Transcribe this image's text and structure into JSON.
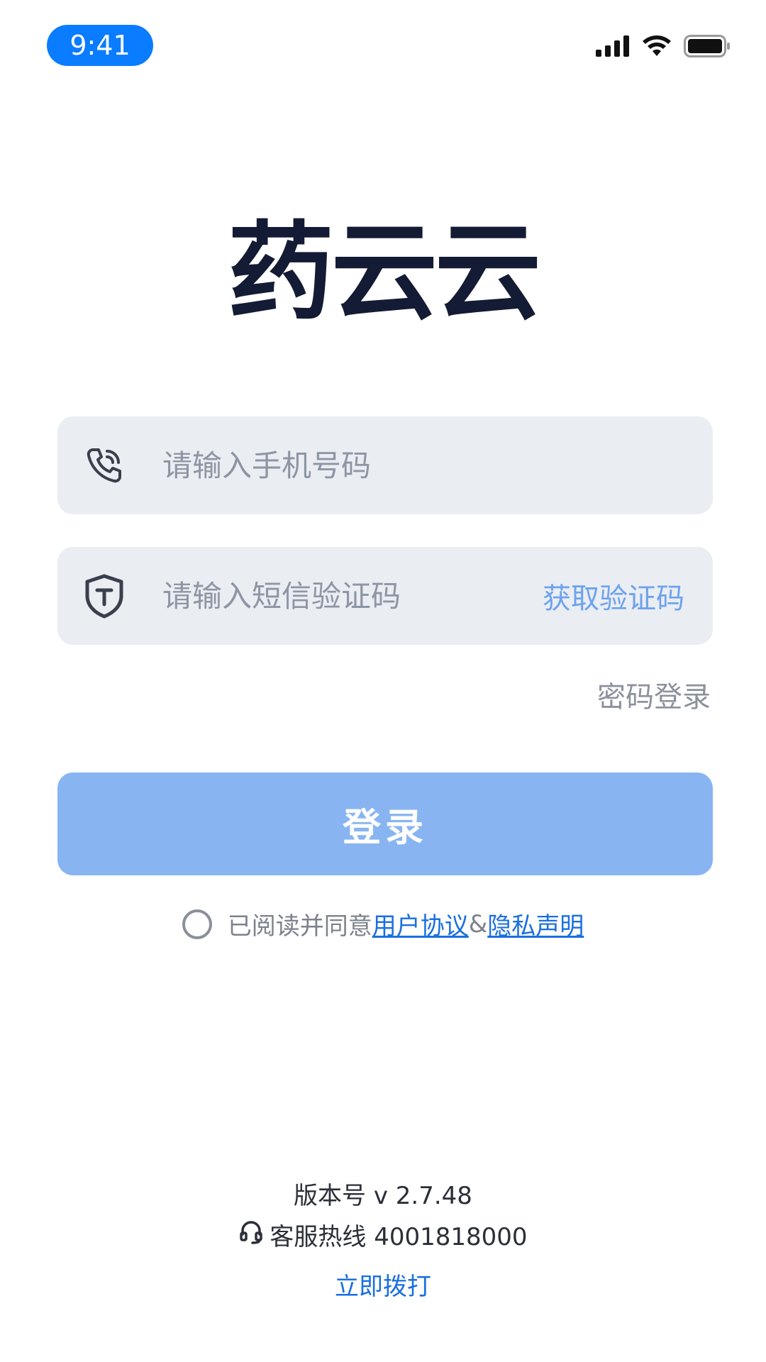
{
  "status_bar": {
    "time": "9:41",
    "icons": [
      "signal-icon",
      "wifi-icon",
      "battery-icon"
    ]
  },
  "app": {
    "logo_text": "药云云"
  },
  "form": {
    "phone_placeholder": "请输入手机号码",
    "code_placeholder": "请输入短信验证码",
    "get_code_label": "获取验证码",
    "password_login_label": "密码登录",
    "login_button_label": "登录"
  },
  "agreement": {
    "prefix": "已阅读并同意",
    "user_agreement": "用户协议",
    "separator": "&",
    "privacy_statement": "隐私声明",
    "checked": false
  },
  "footer": {
    "version_label": "版本号 v 2.7.48",
    "hotline_label": "客服热线 4001818000",
    "call_now_label": "立即拨打"
  },
  "colors": {
    "accent": "#1a6fe0",
    "button_disabled": "#88b5f2",
    "field_bg": "#eaedf2",
    "logo": "#141b34"
  }
}
